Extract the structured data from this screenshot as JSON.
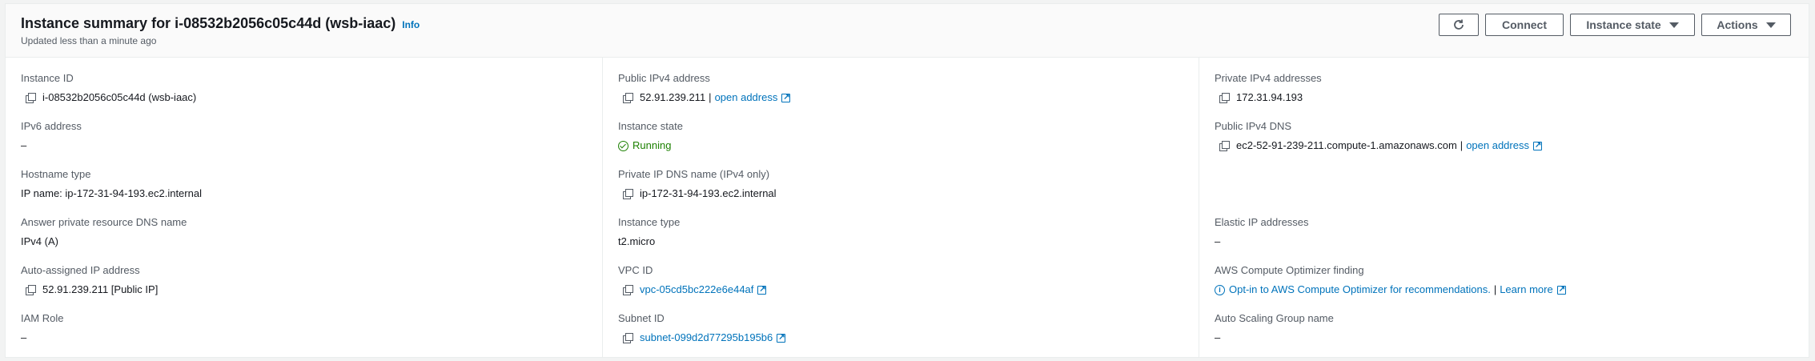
{
  "header": {
    "title": "Instance summary for i-08532b2056c05c44d (wsb-iaac)",
    "info_label": "Info",
    "subtitle": "Updated less than a minute ago",
    "buttons": {
      "refresh_icon": "refresh-icon",
      "connect": "Connect",
      "instance_state": "Instance state",
      "actions": "Actions"
    }
  },
  "fields": {
    "instance_id": {
      "label": "Instance ID",
      "value": "i-08532b2056c05c44d (wsb-iaac)"
    },
    "ipv6": {
      "label": "IPv6 address",
      "value": "–"
    },
    "hostname_type": {
      "label": "Hostname type",
      "value": "IP name: ip-172-31-94-193.ec2.internal"
    },
    "answer_dns": {
      "label": "Answer private resource DNS name",
      "value": "IPv4 (A)"
    },
    "auto_ip": {
      "label": "Auto-assigned IP address",
      "value": "52.91.239.211 [Public IP]"
    },
    "iam_role": {
      "label": "IAM Role",
      "value": "–"
    },
    "public_ipv4": {
      "label": "Public IPv4 address",
      "value": "52.91.239.211",
      "sep": "|",
      "link": "open address"
    },
    "instance_state": {
      "label": "Instance state",
      "value": "Running"
    },
    "private_dns": {
      "label": "Private IP DNS name (IPv4 only)",
      "value": "ip-172-31-94-193.ec2.internal"
    },
    "instance_type": {
      "label": "Instance type",
      "value": "t2.micro"
    },
    "vpc_id": {
      "label": "VPC ID",
      "value": "vpc-05cd5bc222e6e44af"
    },
    "subnet_id": {
      "label": "Subnet ID",
      "value": "subnet-099d2d77295b195b6"
    },
    "private_ipv4": {
      "label": "Private IPv4 addresses",
      "value": "172.31.94.193"
    },
    "public_dns": {
      "label": "Public IPv4 DNS",
      "value": "ec2-52-91-239-211.compute-1.amazonaws.com",
      "sep": "|",
      "link": "open address"
    },
    "elastic_ip": {
      "label": "Elastic IP addresses",
      "value": "–"
    },
    "optimizer": {
      "label": "AWS Compute Optimizer finding",
      "value": "Opt-in to AWS Compute Optimizer for recommendations.",
      "sep": "|",
      "link": "Learn more"
    },
    "asg_name": {
      "label": "Auto Scaling Group name",
      "value": "–"
    }
  },
  "colors": {
    "link": "#0073bb",
    "running": "#1d8102",
    "label": "#545b64"
  }
}
